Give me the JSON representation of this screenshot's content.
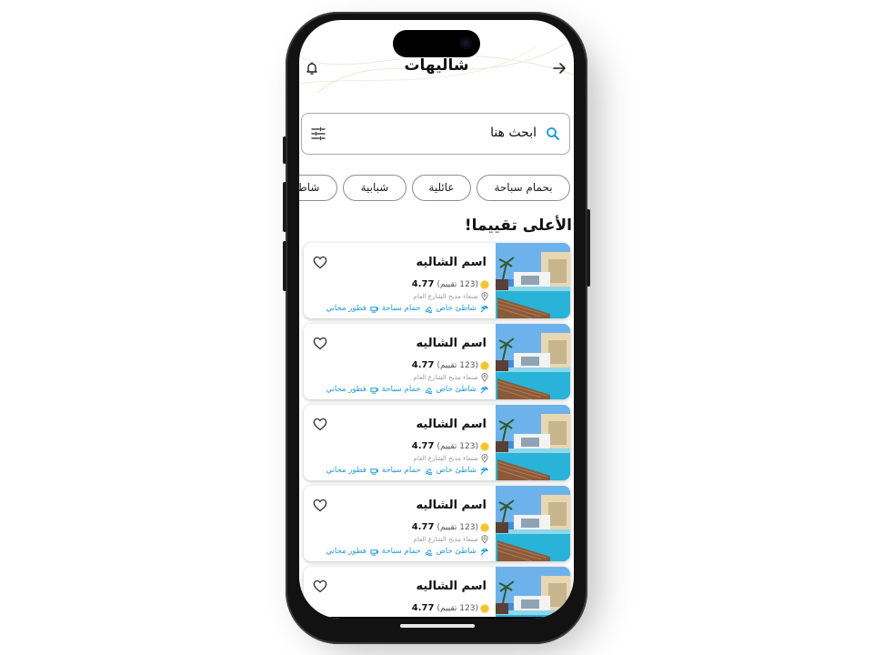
{
  "header": {
    "title": "شاليهات",
    "back_icon": "arrow-right-icon",
    "bell_icon": "bell-icon"
  },
  "search": {
    "placeholder": "ابحث هنا",
    "search_icon": "search-icon",
    "filter_icon": "sliders-icon"
  },
  "chips": [
    {
      "label": "بحمام سباحة"
    },
    {
      "label": "عائلية"
    },
    {
      "label": "شبابية"
    },
    {
      "label": "شاط"
    }
  ],
  "section_title": "الأعلى تقييما!",
  "cards": [
    {
      "name": "اسم الشاليه",
      "reviews": "(123 تقييم)",
      "score": "4.77",
      "location": "صنعاء مذبح الشارع العام",
      "amenities": [
        "شاطئ خاص",
        "حمام سباحة",
        "فطور مجاني"
      ]
    },
    {
      "name": "اسم الشاليه",
      "reviews": "(123 تقييم)",
      "score": "4.77",
      "location": "صنعاء مذبح الشارع العام",
      "amenities": [
        "شاطئ خاص",
        "حمام سباحة",
        "فطور مجاني"
      ]
    },
    {
      "name": "اسم الشاليه",
      "reviews": "(123 تقييم)",
      "score": "4.77",
      "location": "صنعاء مذبح الشارع العام",
      "amenities": [
        "شاطئ خاص",
        "حمام سباحة",
        "فطور مجاني"
      ]
    },
    {
      "name": "اسم الشاليه",
      "reviews": "(123 تقييم)",
      "score": "4.77",
      "location": "صنعاء مذبح الشارع العام",
      "amenities": [
        "شاطئ خاص",
        "حمام سباحة",
        "فطور مجاني"
      ]
    },
    {
      "name": "اسم الشاليه",
      "reviews": "(123 تقييم)",
      "score": "4.77",
      "location": "",
      "amenities": []
    }
  ],
  "colors": {
    "accent": "#1a9ad6",
    "star": "#f4c430",
    "text": "#111111"
  }
}
